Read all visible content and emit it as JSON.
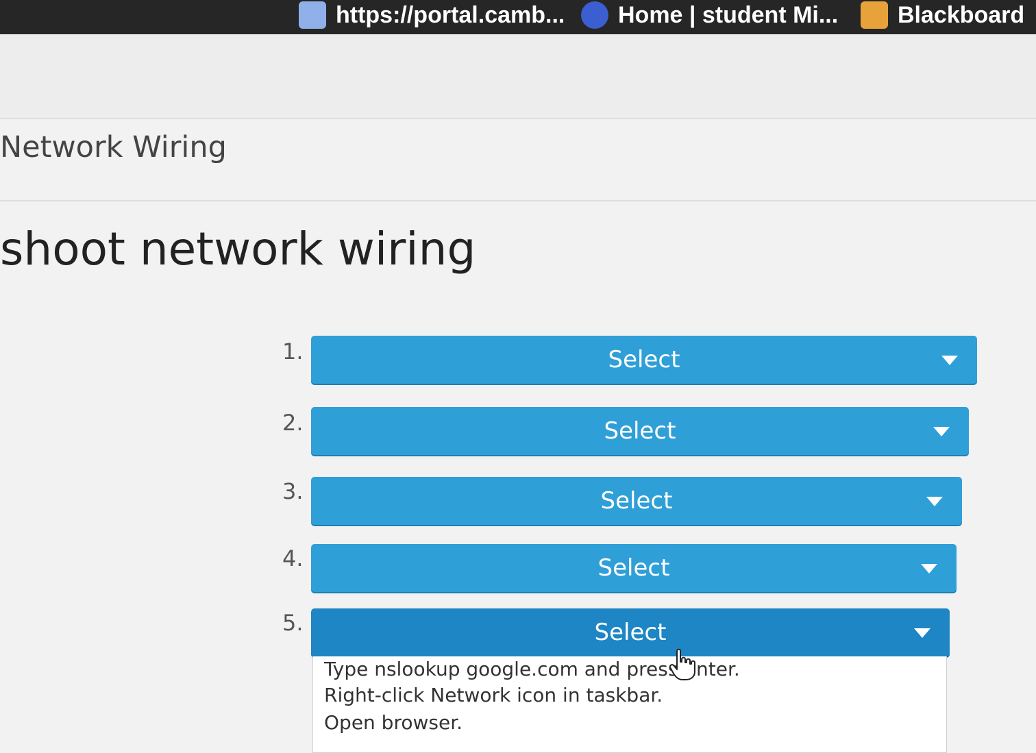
{
  "bookmarks": [
    {
      "label": "https://portal.camb...",
      "icon": "portal-favicon-icon",
      "color": "#8fb0e8"
    },
    {
      "label": "Home | student  Mi...",
      "icon": "student-home-favicon-icon",
      "color": "#3b5fd0"
    },
    {
      "label": "Blackboard",
      "icon": "blackboard-favicon-icon",
      "color": "#e8a23a"
    }
  ],
  "breadcrumb": "Network Wiring",
  "task_title": "shoot network wiring",
  "steps": [
    {
      "number": "1.",
      "select_label": "Select"
    },
    {
      "number": "2.",
      "select_label": "Select"
    },
    {
      "number": "3.",
      "select_label": "Select"
    },
    {
      "number": "4.",
      "select_label": "Select"
    },
    {
      "number": "5.",
      "select_label": "Select"
    }
  ],
  "dropdown_options": [
    "Type nslookup google.com and press Enter.",
    "Right-click Network icon in taskbar.",
    "Open browser."
  ],
  "colors": {
    "select_button": "#2f9fd8",
    "select_button_active": "#1e86c4",
    "bookmarks_bar": "#262626"
  }
}
